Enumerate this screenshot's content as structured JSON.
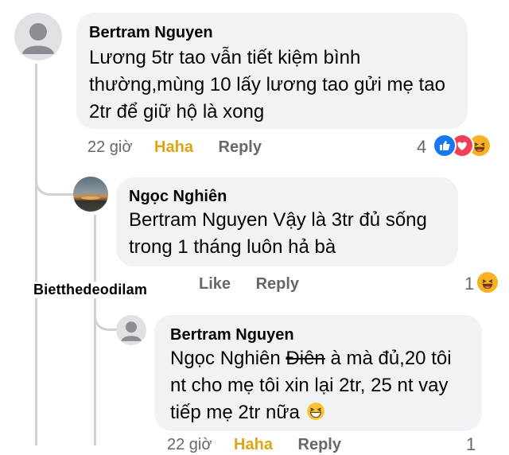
{
  "comments": [
    {
      "author": "Bertram Nguyen",
      "lines": [
        "Lương 5tr tao vẫn tiết kiệm bình",
        "thường,mùng 10 lấy lương tao gửi mẹ tao",
        "2tr để giữ hộ là xong"
      ],
      "time": "22 giờ",
      "action1": "Haha",
      "action2": "Reply",
      "reaction_count": "4",
      "reactions": [
        "like-reaction-icon",
        "love-reaction-icon",
        "haha-reaction-icon"
      ]
    },
    {
      "author": "Ngọc Nghiên",
      "lines": [
        "Bertram Nguyen Vậy là 3tr đủ sống",
        "trong 1 tháng luôn hả bà"
      ],
      "action1": "Like",
      "action2": "Reply",
      "reaction_count": "1",
      "reactions": [
        "haha-reaction-icon"
      ]
    },
    {
      "author": "Bertram Nguyen",
      "mention": "Ngọc Nghiên",
      "struck": "Điên",
      "line1_rest": " à mà đủ,20 tôi",
      "lines": [
        "nt cho mẹ tôi xin lại 2tr, 25 nt vay",
        "tiếp mẹ 2tr nữa"
      ],
      "emoji": "grinning-squint-emoji",
      "time": "22 giờ",
      "action1": "Haha",
      "action2": "Reply",
      "reaction_count": "1"
    }
  ],
  "watermark": "Bietthedeodilam"
}
